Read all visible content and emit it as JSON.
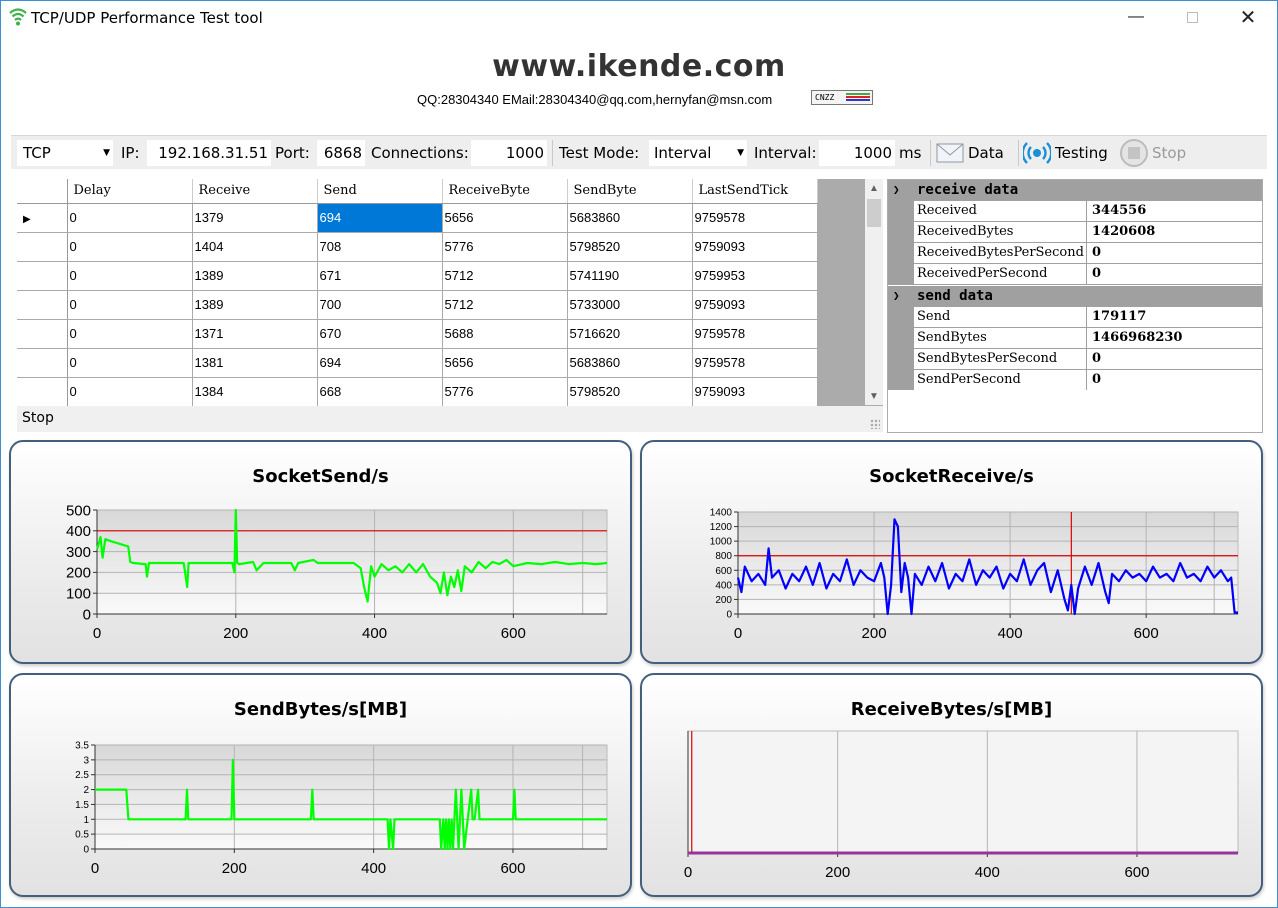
{
  "window": {
    "title": "TCP/UDP Performance Test tool"
  },
  "header": {
    "site": "www.ikende.com",
    "contact": "QQ:28304340 EMail:28304340@qq.com,hernyfan@msn.com",
    "badge": "CNZZ"
  },
  "toolbar": {
    "protocol": "TCP",
    "ip_label": "IP:",
    "ip_value": "192.168.31.51",
    "port_label": "Port:",
    "port_value": "6868",
    "connections_label": "Connections:",
    "connections_value": "1000",
    "test_mode_label": "Test Mode:",
    "test_mode_value": "Interval",
    "interval_label": "Interval:",
    "interval_value": "1000",
    "interval_unit": "ms",
    "data_button": "Data",
    "testing_button": "Testing",
    "stop_button": "Stop"
  },
  "grid": {
    "columns": [
      "Delay",
      "Receive",
      "Send",
      "ReceiveByte",
      "SendByte",
      "LastSendTick"
    ],
    "rows": [
      [
        "0",
        "1379",
        "694",
        "5656",
        "5683860",
        "9759578"
      ],
      [
        "0",
        "1404",
        "708",
        "5776",
        "5798520",
        "9759093"
      ],
      [
        "0",
        "1389",
        "671",
        "5712",
        "5741190",
        "9759953"
      ],
      [
        "0",
        "1389",
        "700",
        "5712",
        "5733000",
        "9759093"
      ],
      [
        "0",
        "1371",
        "670",
        "5688",
        "5716620",
        "9759578"
      ],
      [
        "0",
        "1381",
        "694",
        "5656",
        "5683860",
        "9759578"
      ],
      [
        "0",
        "1384",
        "668",
        "5776",
        "5798520",
        "9759093"
      ]
    ],
    "status": "Stop"
  },
  "properties": {
    "receive": {
      "category": "receive data",
      "items": [
        {
          "key": "Received",
          "value": "344556"
        },
        {
          "key": "ReceivedBytes",
          "value": "1420608"
        },
        {
          "key": "ReceivedBytesPerSecond",
          "value": "0"
        },
        {
          "key": "ReceivedPerSecond",
          "value": "0"
        }
      ]
    },
    "send": {
      "category": "send data",
      "items": [
        {
          "key": "Send",
          "value": "179117"
        },
        {
          "key": "SendBytes",
          "value": "1466968230"
        },
        {
          "key": "SendBytesPerSecond",
          "value": "0"
        },
        {
          "key": "SendPerSecond",
          "value": "0"
        }
      ]
    }
  },
  "colors": {
    "send_series": "#00ff00",
    "receive_series": "#0000ff",
    "bytes_series": "#993399",
    "threshold": "#dd0000"
  },
  "chart_data": [
    {
      "type": "line",
      "title": "SocketSend/s",
      "xlim": [
        0,
        735
      ],
      "ylim": [
        0,
        500
      ],
      "xticks": [
        0,
        200,
        400,
        600
      ],
      "yticks": [
        0,
        100,
        200,
        300,
        400,
        500
      ],
      "threshold": 400,
      "series": [
        {
          "x": [
            0,
            5,
            8,
            12,
            20,
            45,
            48,
            52,
            70,
            72,
            75,
            125,
            130,
            132,
            135,
            195,
            198,
            200,
            202,
            205,
            225,
            230,
            240,
            280,
            285,
            290,
            312,
            318,
            330,
            370,
            380,
            385,
            390,
            395,
            400,
            410,
            420,
            430,
            440,
            450,
            460,
            470,
            480,
            490,
            495,
            500,
            505,
            510,
            515,
            520,
            525,
            530,
            540,
            550,
            560,
            570,
            580,
            590,
            600,
            620,
            640,
            660,
            680,
            700,
            720,
            735
          ],
          "y": [
            310,
            370,
            270,
            360,
            350,
            325,
            250,
            245,
            240,
            180,
            245,
            245,
            130,
            245,
            245,
            245,
            200,
            500,
            245,
            240,
            250,
            210,
            245,
            245,
            210,
            245,
            260,
            245,
            245,
            245,
            220,
            130,
            60,
            230,
            180,
            240,
            210,
            230,
            200,
            240,
            200,
            240,
            180,
            150,
            100,
            200,
            90,
            180,
            130,
            210,
            110,
            230,
            200,
            250,
            220,
            250,
            240,
            260,
            230,
            245,
            240,
            250,
            240,
            245,
            240,
            245
          ]
        }
      ]
    },
    {
      "type": "line",
      "title": "SocketReceive/s",
      "xlim": [
        0,
        735
      ],
      "ylim": [
        0,
        1400
      ],
      "xticks": [
        0,
        200,
        400,
        600
      ],
      "yticks": [
        0,
        200,
        400,
        600,
        800,
        1000,
        1200,
        1400
      ],
      "threshold": 800,
      "marker_x": 490,
      "series": [
        {
          "x": [
            0,
            5,
            10,
            20,
            30,
            40,
            45,
            50,
            60,
            70,
            80,
            90,
            100,
            110,
            120,
            130,
            140,
            150,
            160,
            170,
            180,
            190,
            200,
            210,
            215,
            220,
            225,
            230,
            235,
            240,
            245,
            250,
            255,
            260,
            270,
            280,
            290,
            300,
            310,
            320,
            330,
            340,
            350,
            360,
            370,
            380,
            390,
            400,
            410,
            420,
            430,
            440,
            450,
            460,
            470,
            480,
            485,
            490,
            495,
            500,
            510,
            520,
            530,
            540,
            545,
            550,
            560,
            570,
            580,
            590,
            600,
            610,
            620,
            630,
            640,
            650,
            660,
            670,
            680,
            690,
            700,
            710,
            720,
            725,
            730,
            735
          ],
          "y": [
            500,
            300,
            650,
            450,
            550,
            400,
            900,
            500,
            600,
            350,
            550,
            450,
            650,
            400,
            700,
            350,
            550,
            450,
            750,
            400,
            600,
            500,
            450,
            700,
            500,
            0,
            400,
            1300,
            1200,
            300,
            700,
            500,
            0,
            550,
            400,
            650,
            450,
            700,
            350,
            550,
            450,
            750,
            400,
            600,
            500,
            650,
            350,
            550,
            450,
            750,
            400,
            600,
            700,
            300,
            600,
            200,
            50,
            400,
            0,
            350,
            650,
            400,
            700,
            300,
            150,
            550,
            450,
            600,
            500,
            550,
            450,
            650,
            500,
            550,
            450,
            700,
            500,
            550,
            450,
            650,
            500,
            600,
            450,
            500,
            20,
            20
          ]
        }
      ]
    },
    {
      "type": "line",
      "title": "SendBytes/s[MB]",
      "xlim": [
        0,
        735
      ],
      "ylim": [
        0,
        3.5
      ],
      "xticks": [
        0,
        200,
        400,
        600
      ],
      "yticks": [
        0,
        0.5,
        1,
        1.5,
        2,
        2.5,
        3,
        3.5
      ],
      "series": [
        {
          "x": [
            0,
            45,
            48,
            130,
            132,
            134,
            196,
            198,
            200,
            202,
            310,
            312,
            314,
            420,
            422,
            424,
            428,
            430,
            432,
            495,
            497,
            500,
            502,
            504,
            506,
            508,
            510,
            512,
            514,
            516,
            518,
            520,
            522,
            524,
            526,
            528,
            530,
            535,
            540,
            542,
            545,
            550,
            552,
            554,
            600,
            602,
            604,
            735
          ],
          "y": [
            2,
            2,
            1,
            1,
            2,
            1,
            1,
            3,
            1,
            1,
            1,
            2,
            1,
            1,
            0,
            1,
            0,
            1,
            1,
            1,
            0,
            1,
            0,
            1,
            0,
            1,
            0,
            1,
            0,
            1,
            2,
            1,
            0,
            1,
            2,
            1,
            0,
            1,
            2,
            1,
            1,
            2,
            1,
            1,
            1,
            2,
            1,
            1
          ]
        }
      ]
    },
    {
      "type": "line",
      "title": "ReceiveBytes/s[MB]",
      "xlim": [
        0,
        735
      ],
      "xticks": [
        0,
        200,
        400,
        600
      ],
      "marker_x": 5,
      "series": [
        {
          "x": [
            0,
            735
          ],
          "y": [
            0,
            0
          ]
        }
      ]
    }
  ]
}
